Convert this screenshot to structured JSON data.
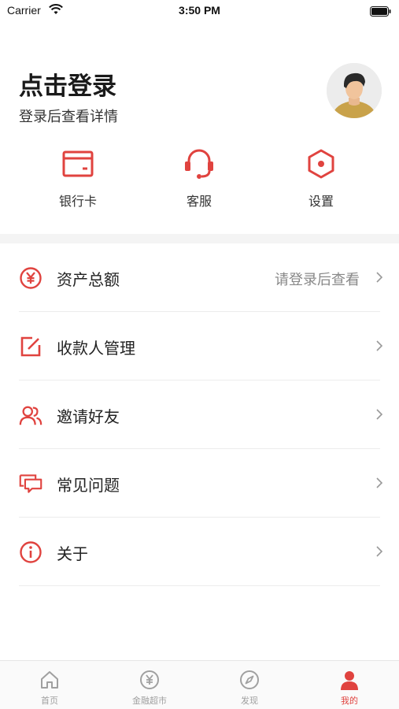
{
  "status_bar": {
    "carrier": "Carrier",
    "time": "3:50 PM"
  },
  "header": {
    "title": "点击登录",
    "subtitle": "登录后查看详情"
  },
  "shortcuts": [
    {
      "label": "银行卡",
      "icon": "bank-card-icon"
    },
    {
      "label": "客服",
      "icon": "headset-icon"
    },
    {
      "label": "设置",
      "icon": "settings-hexagon-icon"
    }
  ],
  "menu": [
    {
      "label": "资产总额",
      "hint": "请登录后查看",
      "icon": "yen-circle-icon"
    },
    {
      "label": "收款人管理",
      "hint": "",
      "icon": "edit-icon"
    },
    {
      "label": "邀请好友",
      "hint": "",
      "icon": "users-icon"
    },
    {
      "label": "常见问题",
      "hint": "",
      "icon": "chat-icon"
    },
    {
      "label": "关于",
      "hint": "",
      "icon": "info-icon"
    }
  ],
  "tabs": [
    {
      "label": "首页",
      "icon": "home-icon",
      "active": false
    },
    {
      "label": "金融超市",
      "icon": "yen-circle-icon",
      "active": false
    },
    {
      "label": "发现",
      "icon": "compass-icon",
      "active": false
    },
    {
      "label": "我的",
      "icon": "person-icon",
      "active": true
    }
  ],
  "colors": {
    "accent": "#e0433f",
    "text": "#222222",
    "muted": "#888888",
    "tab_inactive": "#a0a0a0"
  }
}
